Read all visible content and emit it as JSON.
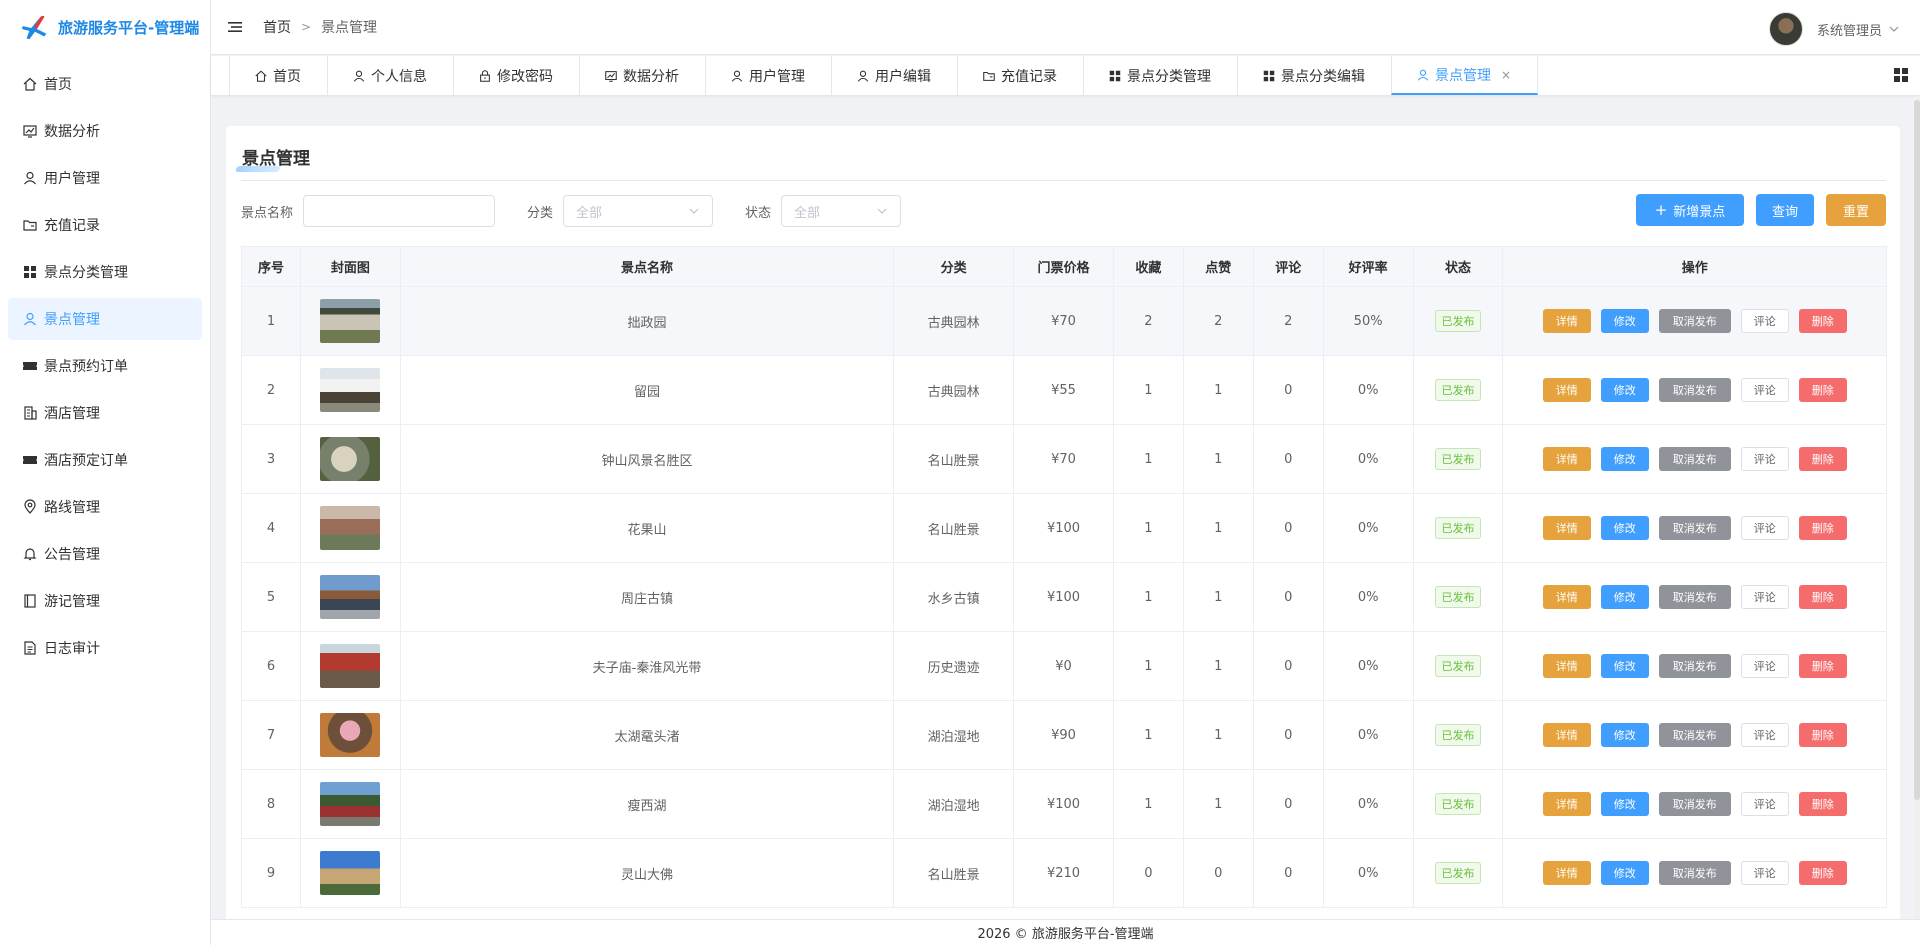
{
  "app": {
    "title": "旅游服务平台-管理端"
  },
  "header": {
    "breadcrumb": [
      "首页",
      "景点管理"
    ],
    "user_name": "系统管理员"
  },
  "sidebar": {
    "items": [
      {
        "label": "首页",
        "icon": "home-icon"
      },
      {
        "label": "数据分析",
        "icon": "chart-icon"
      },
      {
        "label": "用户管理",
        "icon": "user-icon"
      },
      {
        "label": "充值记录",
        "icon": "folder-icon"
      },
      {
        "label": "景点分类管理",
        "icon": "grid-icon"
      },
      {
        "label": "景点管理",
        "icon": "user-icon",
        "active": true
      },
      {
        "label": "景点预约订单",
        "icon": "ticket-icon"
      },
      {
        "label": "酒店管理",
        "icon": "building-icon"
      },
      {
        "label": "酒店预定订单",
        "icon": "ticket-icon"
      },
      {
        "label": "路线管理",
        "icon": "location-icon"
      },
      {
        "label": "公告管理",
        "icon": "bell-icon"
      },
      {
        "label": "游记管理",
        "icon": "notebook-icon"
      },
      {
        "label": "日志审计",
        "icon": "document-icon"
      }
    ]
  },
  "tabs": [
    {
      "label": "首页",
      "icon": "home-icon"
    },
    {
      "label": "个人信息",
      "icon": "user-icon"
    },
    {
      "label": "修改密码",
      "icon": "lock-icon"
    },
    {
      "label": "数据分析",
      "icon": "chart-icon"
    },
    {
      "label": "用户管理",
      "icon": "user-icon"
    },
    {
      "label": "用户编辑",
      "icon": "user-icon"
    },
    {
      "label": "充值记录",
      "icon": "folder-icon"
    },
    {
      "label": "景点分类管理",
      "icon": "grid-icon"
    },
    {
      "label": "景点分类编辑",
      "icon": "grid-icon"
    },
    {
      "label": "景点管理",
      "icon": "user-icon",
      "active": true,
      "close": "×"
    }
  ],
  "page": {
    "title": "景点管理",
    "filters": {
      "name_label": "景点名称",
      "category_label": "分类",
      "category_value": "全部",
      "status_label": "状态",
      "status_value": "全部"
    },
    "buttons": {
      "add": "新增景点",
      "add_icon": "+",
      "query": "查询",
      "reset": "重置"
    }
  },
  "table": {
    "columns": [
      "序号",
      "封面图",
      "景点名称",
      "分类",
      "门票价格",
      "收藏",
      "点赞",
      "评论",
      "好评率",
      "状态",
      "操作"
    ],
    "op_labels": {
      "detail": "详情",
      "edit": "修改",
      "unpublish": "取消发布",
      "comment": "评论",
      "delete": "删除"
    },
    "rows": [
      {
        "no": "1",
        "name": "拙政园",
        "category": "古典园林",
        "price": "¥70",
        "fav": "2",
        "like": "2",
        "comment": "2",
        "rate": "50%",
        "status": "已发布"
      },
      {
        "no": "2",
        "name": "留园",
        "category": "古典园林",
        "price": "¥55",
        "fav": "1",
        "like": "1",
        "comment": "0",
        "rate": "0%",
        "status": "已发布"
      },
      {
        "no": "3",
        "name": "钟山风景名胜区",
        "category": "名山胜景",
        "price": "¥70",
        "fav": "1",
        "like": "1",
        "comment": "0",
        "rate": "0%",
        "status": "已发布"
      },
      {
        "no": "4",
        "name": "花果山",
        "category": "名山胜景",
        "price": "¥100",
        "fav": "1",
        "like": "1",
        "comment": "0",
        "rate": "0%",
        "status": "已发布"
      },
      {
        "no": "5",
        "name": "周庄古镇",
        "category": "水乡古镇",
        "price": "¥100",
        "fav": "1",
        "like": "1",
        "comment": "0",
        "rate": "0%",
        "status": "已发布"
      },
      {
        "no": "6",
        "name": "夫子庙-秦淮风光带",
        "category": "历史遗迹",
        "price": "¥0",
        "fav": "1",
        "like": "1",
        "comment": "0",
        "rate": "0%",
        "status": "已发布"
      },
      {
        "no": "7",
        "name": "太湖鼋头渚",
        "category": "湖泊湿地",
        "price": "¥90",
        "fav": "1",
        "like": "1",
        "comment": "0",
        "rate": "0%",
        "status": "已发布"
      },
      {
        "no": "8",
        "name": "瘦西湖",
        "category": "湖泊湿地",
        "price": "¥100",
        "fav": "1",
        "like": "1",
        "comment": "0",
        "rate": "0%",
        "status": "已发布"
      },
      {
        "no": "9",
        "name": "灵山大佛",
        "category": "名山胜景",
        "price": "¥210",
        "fav": "0",
        "like": "0",
        "comment": "0",
        "rate": "0%",
        "status": "已发布"
      }
    ]
  },
  "footer": {
    "text": "2026 © 旅游服务平台-管理端"
  },
  "colors": {
    "primary": "#409eff",
    "warning": "#e6a23c",
    "danger": "#f56c6c",
    "info": "#909399",
    "success": "#67c23a"
  }
}
